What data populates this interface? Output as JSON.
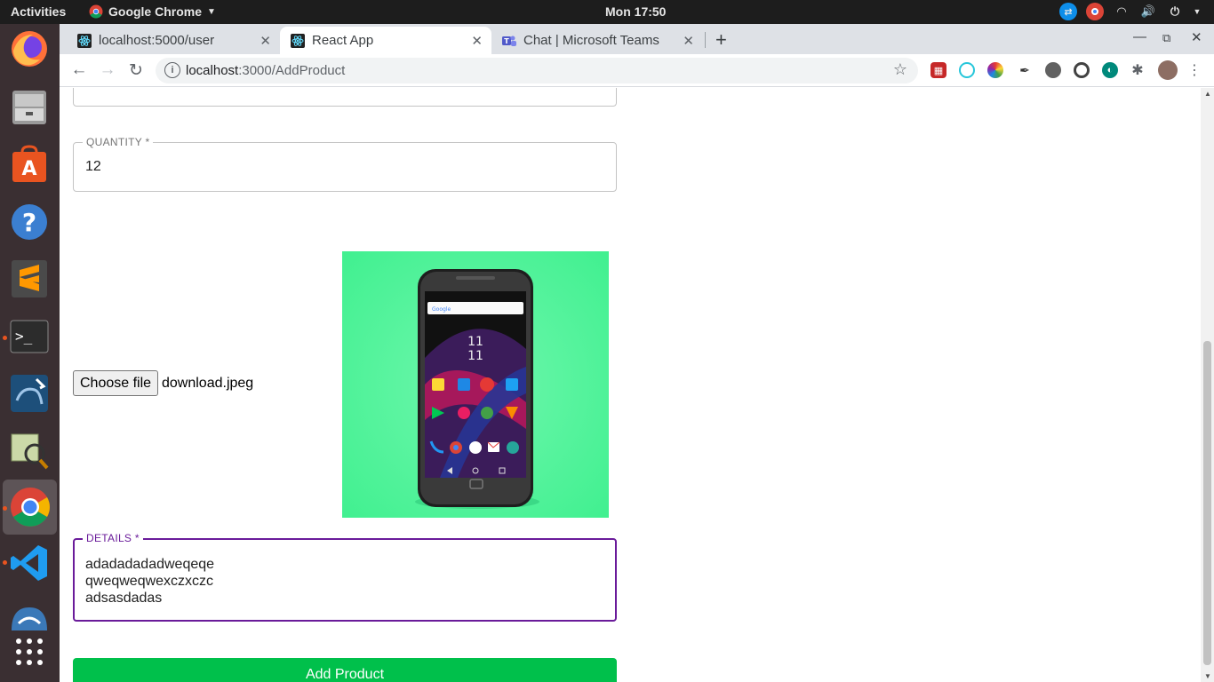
{
  "topbar": {
    "activities": "Activities",
    "app_name": "Google Chrome",
    "clock": "Mon 17:50"
  },
  "tabs": [
    {
      "title": "localhost:5000/user",
      "icon": "react-icon"
    },
    {
      "title": "React App",
      "icon": "react-icon"
    },
    {
      "title": "Chat | Microsoft Teams",
      "icon": "teams-icon"
    }
  ],
  "address": {
    "host": "localhost",
    "path": ":3000/AddProduct"
  },
  "form": {
    "quantity": {
      "label": "QUANTITY *",
      "value": "12"
    },
    "file": {
      "button_label": "Choose file",
      "filename": "download.jpeg"
    },
    "details": {
      "label": "DETAILS *",
      "lines": [
        "adadadadadweqeqe",
        "qweqweqwexczxczc",
        "adsasdadas"
      ]
    },
    "submit_label": "Add Product"
  },
  "phone_preview": {
    "clock_hour": "11",
    "clock_minute": "11",
    "search_hint": "Google"
  },
  "colors": {
    "accent_purple": "#6a1b9a",
    "submit_green": "#00c04b",
    "preview_bg": "#4ff59a"
  }
}
